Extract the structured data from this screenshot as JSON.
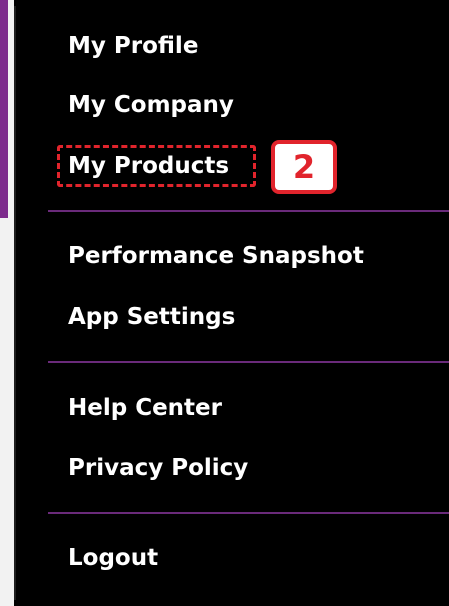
{
  "menu": {
    "items": [
      {
        "label": "My Profile"
      },
      {
        "label": "My Company"
      },
      {
        "label": "My Products"
      },
      {
        "label": "Performance Snapshot"
      },
      {
        "label": "App Settings"
      },
      {
        "label": "Help Center"
      },
      {
        "label": "Privacy Policy"
      },
      {
        "label": "Logout"
      }
    ]
  },
  "annotation": {
    "step_number": "2"
  },
  "colors": {
    "panel_background": "#000000",
    "divider": "#6a2a7a",
    "highlight": "#e1242c",
    "side_accent": "#7d2b8c"
  }
}
